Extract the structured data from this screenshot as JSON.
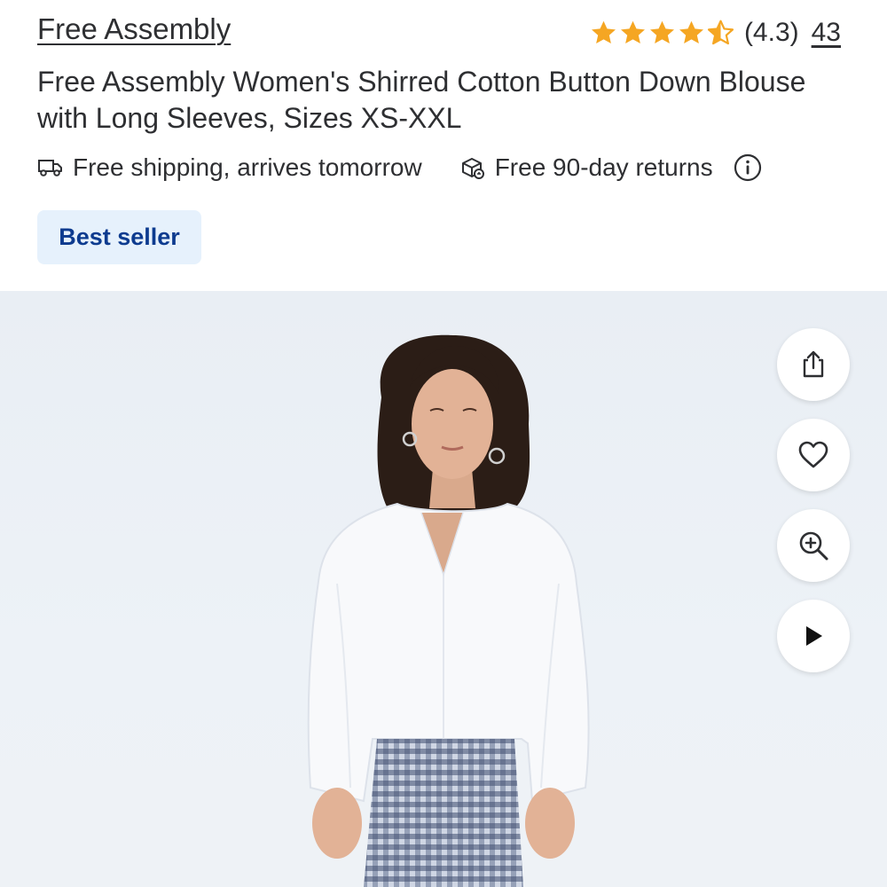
{
  "product": {
    "brand": "Free Assembly",
    "rating_value": "(4.3)",
    "rating_stars": 4.3,
    "review_count": "43",
    "title": "Free Assembly Women's Shirred Cotton Button Down Blouse with Long Sleeves, Sizes XS-XXL",
    "badge": "Best seller"
  },
  "perks": {
    "shipping": "Free shipping, arrives tomorrow",
    "returns": "Free 90-day returns"
  },
  "icons": {
    "shipping": "truck-icon",
    "returns": "return-box-icon",
    "info": "info-icon",
    "share": "share-icon",
    "favorite": "heart-icon",
    "zoom": "zoom-in-icon",
    "video": "play-icon"
  },
  "colors": {
    "star": "#f5a623",
    "badge_bg": "#e6f1fc",
    "badge_text": "#0d3b8f",
    "text": "#2e2f32"
  }
}
